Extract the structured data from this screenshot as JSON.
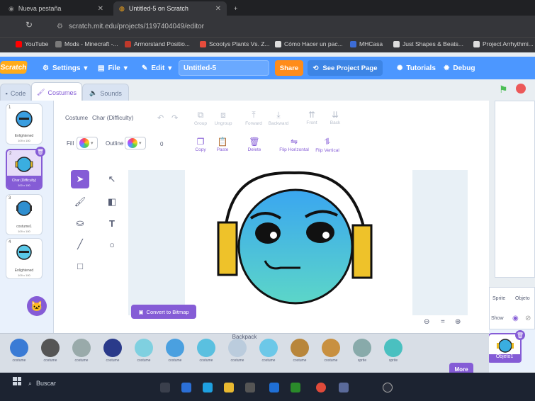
{
  "browser": {
    "tabs": [
      {
        "label": "Nueva pestaña"
      },
      {
        "label": "Untitled-5 on Scratch"
      }
    ],
    "new_tab": "+",
    "address": "scratch.mit.edu/projects/1197404049/editor",
    "bookmarks": [
      {
        "label": "YouTube",
        "color": "#ff0000"
      },
      {
        "label": "Mods - Minecraft -...",
        "color": "#7a7a7a"
      },
      {
        "label": "Armorstand Positio...",
        "color": "#c0392b"
      },
      {
        "label": "Scootys Plants Vs. Z...",
        "color": "#e74c3c"
      },
      {
        "label": "Cómo Hacer un pac...",
        "color": "#ffffff"
      },
      {
        "label": "MHCasa",
        "color": "#3c6cd6"
      },
      {
        "label": "Just Shapes & Beats...",
        "color": "#ffffff"
      },
      {
        "label": "Project Arrhythmi...",
        "color": "#ffffff"
      }
    ]
  },
  "menubar": {
    "logo": "Scratch",
    "settings": "Settings",
    "file": "File",
    "edit": "Edit",
    "project_title": "Untitled-5",
    "share": "Share",
    "see_project": "See Project Page",
    "tutorials": "Tutorials",
    "debug": "Debug"
  },
  "editor_tabs": {
    "code": "Code",
    "costumes": "Costumes",
    "sounds": "Sounds"
  },
  "costumes": [
    {
      "num": "1",
      "name": "Enlightened",
      "size": "109 x 100"
    },
    {
      "num": "2",
      "name": "Char (Difficulty)",
      "size": "100 x 100"
    },
    {
      "num": "3",
      "name": "costume1",
      "size": "109 x 100"
    },
    {
      "num": "4",
      "name": "Enlightened",
      "size": "109 x 100"
    }
  ],
  "paint": {
    "costume_label": "Costume",
    "costume_name": "Char (Difficulty)",
    "group": "Group",
    "ungroup": "Ungroup",
    "forward": "Forward",
    "backward": "Backward",
    "front": "Front",
    "back": "Back",
    "fill_label": "Fill",
    "outline_label": "Outline",
    "outline_value": "0",
    "copy": "Copy",
    "paste": "Paste",
    "delete": "Delete",
    "flip_h": "Flip Horizontal",
    "flip_v": "Flip Vertical",
    "convert": "Convert to Bitmap",
    "zoom_out": "⊖",
    "zoom_reset": "=",
    "zoom_in": "⊕"
  },
  "sprite_panel": {
    "sprite_label": "Sprite",
    "sprite_name": "Objeto",
    "show_label": "Show",
    "selected_sprite": "Objeto1"
  },
  "backpack": {
    "title": "Backpack",
    "items": [
      {
        "label": "costume",
        "color": "#3a7bd5"
      },
      {
        "label": "costume",
        "color": "#555"
      },
      {
        "label": "costume",
        "color": "#9aa"
      },
      {
        "label": "costume",
        "color": "#2a3a8a"
      },
      {
        "label": "costume",
        "color": "#7fd0e0"
      },
      {
        "label": "costume",
        "color": "#4aa0e0"
      },
      {
        "label": "costume",
        "color": "#5ac0e0"
      },
      {
        "label": "costume",
        "color": "#bcd"
      },
      {
        "label": "costume",
        "color": "#6cc8e8"
      },
      {
        "label": "costume",
        "color": "#b8863b"
      },
      {
        "label": "costume",
        "color": "#c89040"
      },
      {
        "label": "sprite",
        "color": "#8aa"
      },
      {
        "label": "sprite",
        "color": "#4ac0c0"
      }
    ],
    "more": "More"
  },
  "taskbar": {
    "search": "Buscar"
  }
}
